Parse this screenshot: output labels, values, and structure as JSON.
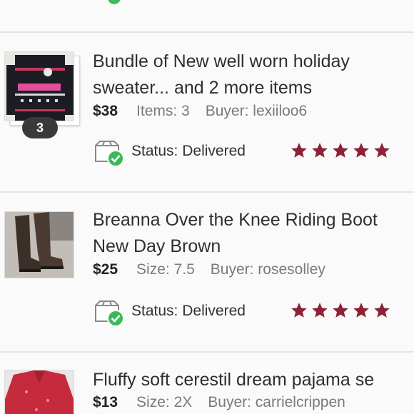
{
  "colors": {
    "star": "#8b2336",
    "check": "#3cb85c",
    "divider": "#e6e3e6",
    "badge": "#3a3a3a"
  },
  "orders": [
    {
      "title_line1": "Bundle of New well worn holiday",
      "title_line2": "sweater... and 2 more items",
      "price": "$38",
      "detail": "Items: 3",
      "buyer": "Buyer: lexiiloo6",
      "status_label": "Status:",
      "status_value": "Delivered",
      "rating": 5,
      "bundle_count": "3",
      "image": "sweater-photo"
    },
    {
      "title_line1": "Breanna Over the Knee Riding Boot",
      "title_line2": "New Day Brown",
      "price": "$25",
      "detail": "Size: 7.5",
      "buyer": "Buyer: rosesolley",
      "status_label": "Status:",
      "status_value": "Delivered",
      "rating": 5,
      "image": "boots-photo"
    },
    {
      "title_line1": "Fluffy soft cerestil dream pajama se",
      "price": "$13",
      "detail": "Size: 2X",
      "buyer": "Buyer: carrielcrippen",
      "image": "pajama-photo"
    }
  ]
}
